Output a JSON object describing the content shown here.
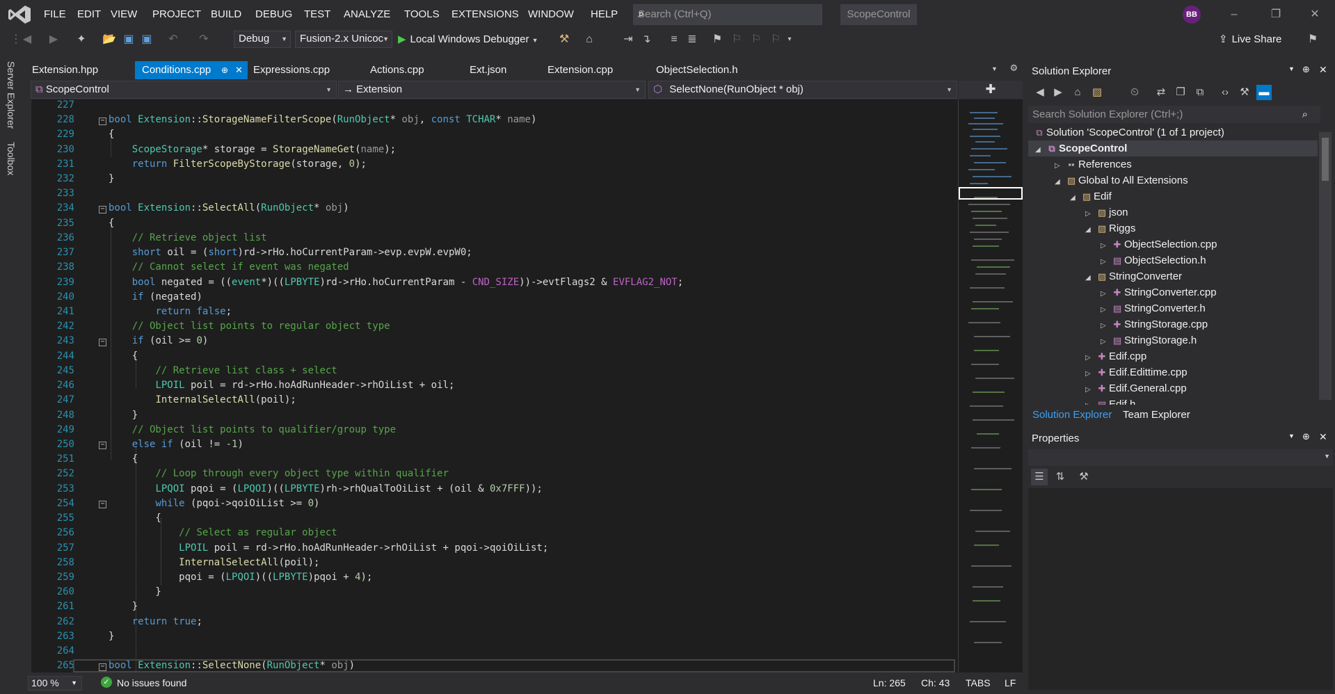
{
  "titlebar": {
    "menus": [
      "FILE",
      "EDIT",
      "VIEW",
      "PROJECT",
      "BUILD",
      "DEBUG",
      "TEST",
      "ANALYZE",
      "TOOLS",
      "EXTENSIONS",
      "WINDOW",
      "HELP"
    ],
    "search_placeholder": "Search (Ctrl+Q)",
    "solution_name": "ScopeControl",
    "avatar_initials": "BB"
  },
  "toolbar": {
    "config": "Debug",
    "platform": "Fusion-2.x Unicoc",
    "run_label": "Local Windows Debugger",
    "live_share": "Live Share"
  },
  "siderail": {
    "server_explorer": "Server Explorer",
    "toolbox": "Toolbox"
  },
  "tabs": [
    {
      "label": "Extension.hpp"
    },
    {
      "label": "Conditions.cpp",
      "active": true
    },
    {
      "label": "Expressions.cpp"
    },
    {
      "label": "Actions.cpp"
    },
    {
      "label": "Ext.json"
    },
    {
      "label": "Extension.cpp"
    },
    {
      "label": "ObjectSelection.h"
    }
  ],
  "navbar": {
    "project": "ScopeControl",
    "scope": "Extension",
    "member": "SelectNone(RunObject * obj)"
  },
  "editor": {
    "line_numbers": [
      "227",
      "228",
      "229",
      "230",
      "231",
      "232",
      "233",
      "234",
      "235",
      "236",
      "237",
      "238",
      "239",
      "240",
      "241",
      "242",
      "243",
      "244",
      "245",
      "246",
      "247",
      "248",
      "249",
      "250",
      "251",
      "252",
      "253",
      "254",
      "255",
      "256",
      "257",
      "258",
      "259",
      "260",
      "261",
      "262",
      "263",
      "264",
      "265"
    ]
  },
  "status": {
    "zoom": "100 %",
    "issues": "No issues found",
    "line": "Ln: 265",
    "col": "Ch: 43",
    "indent": "TABS",
    "eol": "LF"
  },
  "solution_explorer": {
    "title": "Solution Explorer",
    "search_placeholder": "Search Solution Explorer (Ctrl+;)",
    "tree": [
      {
        "label": "Solution 'ScopeControl' (1 of 1 project)",
        "depth": 0,
        "icon": "solution-icon"
      },
      {
        "label": "ScopeControl",
        "depth": 1,
        "icon": "project-icon",
        "selected": true
      },
      {
        "label": "References",
        "depth": 2,
        "icon": "references-icon"
      },
      {
        "label": "Global to All Extensions",
        "depth": 2,
        "icon": "folder-icon"
      },
      {
        "label": "Edif",
        "depth": 3,
        "icon": "folder-icon"
      },
      {
        "label": "json",
        "depth": 4,
        "icon": "folder-icon"
      },
      {
        "label": "Riggs",
        "depth": 4,
        "icon": "folder-icon"
      },
      {
        "label": "ObjectSelection.cpp",
        "depth": 5,
        "icon": "cpp-file-icon"
      },
      {
        "label": "ObjectSelection.h",
        "depth": 5,
        "icon": "header-file-icon"
      },
      {
        "label": "StringConverter",
        "depth": 4,
        "icon": "folder-icon"
      },
      {
        "label": "StringConverter.cpp",
        "depth": 5,
        "icon": "cpp-file-icon"
      },
      {
        "label": "StringConverter.h",
        "depth": 5,
        "icon": "header-file-icon"
      },
      {
        "label": "StringStorage.cpp",
        "depth": 5,
        "icon": "cpp-file-icon"
      },
      {
        "label": "StringStorage.h",
        "depth": 5,
        "icon": "header-file-icon"
      },
      {
        "label": "Edif.cpp",
        "depth": 4,
        "icon": "cpp-file-icon"
      },
      {
        "label": "Edif.Edittime.cpp",
        "depth": 4,
        "icon": "cpp-file-icon"
      },
      {
        "label": "Edif.General.cpp",
        "depth": 4,
        "icon": "cpp-file-icon"
      },
      {
        "label": "Edif.h",
        "depth": 4,
        "icon": "header-file-icon"
      }
    ],
    "tab_active": "Solution Explorer",
    "tab_other": "Team Explorer"
  },
  "properties": {
    "title": "Properties"
  },
  "colors": {
    "accent": "#007acc",
    "editor_bg": "#1e1e1e",
    "chrome_bg": "#2d2d30"
  }
}
